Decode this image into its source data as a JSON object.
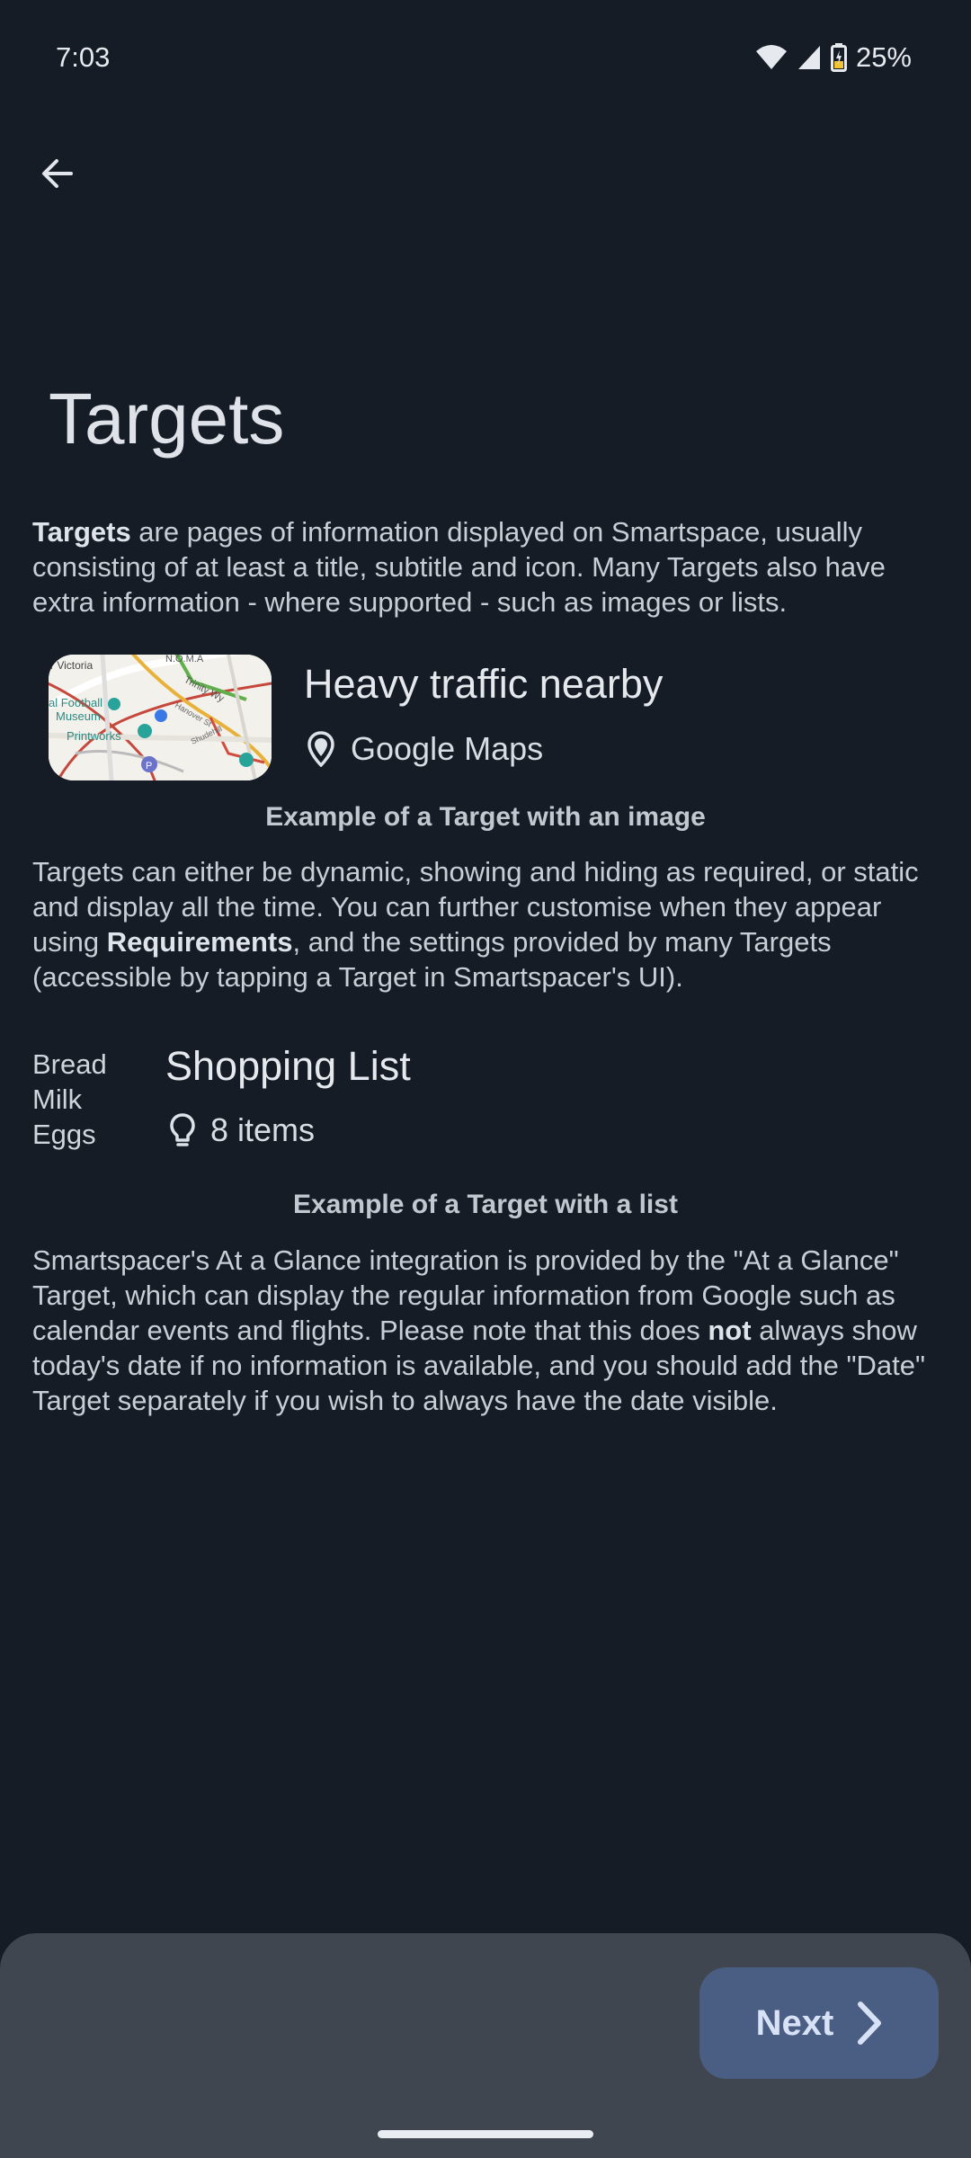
{
  "status_bar": {
    "time": "7:03",
    "battery": "25%"
  },
  "header": {
    "back_icon": "arrow-back-icon",
    "title": "Targets"
  },
  "intro": {
    "bold_term": "Targets",
    "text": " are pages of information displayed on Smartspace, usually consisting of at least a title, subtitle and icon. Many Targets also have extra information - where supported - such as images or lists."
  },
  "example_image_target": {
    "title": "Heavy traffic nearby",
    "subtitle": "Google Maps",
    "icon": "map-pin-icon",
    "caption": "Example of a Target with an image",
    "map_labels": {
      "victoria": "r Victoria",
      "museum_1": "al Football",
      "museum_2": "Museum",
      "printworks": "Printworks",
      "roma": "N.O.M.A",
      "trinity": "Trinity Wy",
      "hanover": "Hanover St",
      "shudehill": "Shudehill"
    }
  },
  "dynamic_paragraph": {
    "text_1": "Targets can either be dynamic, showing and hiding as required, or static and display all the time. You can further customise when they appear using ",
    "bold_term": "Requirements",
    "text_2": ", and the settings provided by many Targets (accessible by tapping a Target in Smartspacer's UI)."
  },
  "example_list_target": {
    "items": [
      "Bread",
      "Milk",
      "Eggs"
    ],
    "title": "Shopping List",
    "subtitle": "8 items",
    "icon": "lightbulb-icon",
    "caption": "Example of a Target with a list"
  },
  "at_a_glance_paragraph": {
    "text_1": "Smartspacer's At a Glance integration is provided by the \"At a Glance\" Target, which can display the regular information from Google such as calendar events and flights. Please note that this does ",
    "bold_term": "not",
    "text_2": " always show today's date if no information is available, and you should add the \"Date\" Target separately if you wish to always have the date visible."
  },
  "bottom_bar": {
    "next_label": "Next",
    "next_icon": "chevron-right-icon"
  },
  "colors": {
    "background": "#161c25",
    "bottom_bar": "#40464f",
    "next_button": "#4a5d82"
  }
}
